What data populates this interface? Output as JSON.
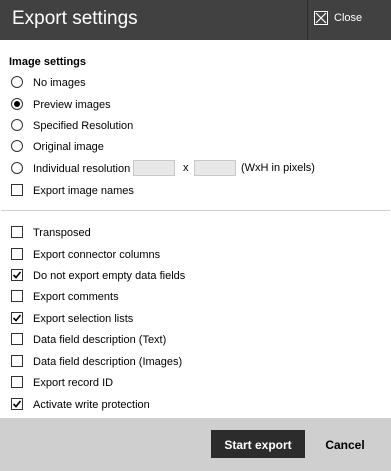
{
  "dialog": {
    "title": "Export settings",
    "close_label": "Close",
    "close_icon": "close-icon"
  },
  "image_settings": {
    "section_title": "Image settings",
    "options": [
      {
        "label": "No images",
        "checked": false
      },
      {
        "label": "Preview images",
        "checked": true
      },
      {
        "label": "Specified Resolution",
        "checked": false
      },
      {
        "label": "Original image",
        "checked": false
      },
      {
        "label": "Individual resolution",
        "checked": false
      }
    ],
    "resolution": {
      "width_value": "",
      "height_value": "",
      "separator": "x",
      "hint": "(WxH in pixels)"
    },
    "export_image_names": {
      "label": "Export image names",
      "checked": false
    }
  },
  "options": [
    {
      "label": "Transposed",
      "checked": false
    },
    {
      "label": "Export connector columns",
      "checked": false
    },
    {
      "label": "Do not export empty data fields",
      "checked": true
    },
    {
      "label": "Export comments",
      "checked": false
    },
    {
      "label": "Export selection lists",
      "checked": true
    },
    {
      "label": "Data field description (Text)",
      "checked": false
    },
    {
      "label": "Data field description (Images)",
      "checked": false
    },
    {
      "label": "Export record ID",
      "checked": false
    },
    {
      "label": "Activate write protection",
      "checked": true
    }
  ],
  "footer": {
    "start_label": "Start export",
    "cancel_label": "Cancel"
  }
}
